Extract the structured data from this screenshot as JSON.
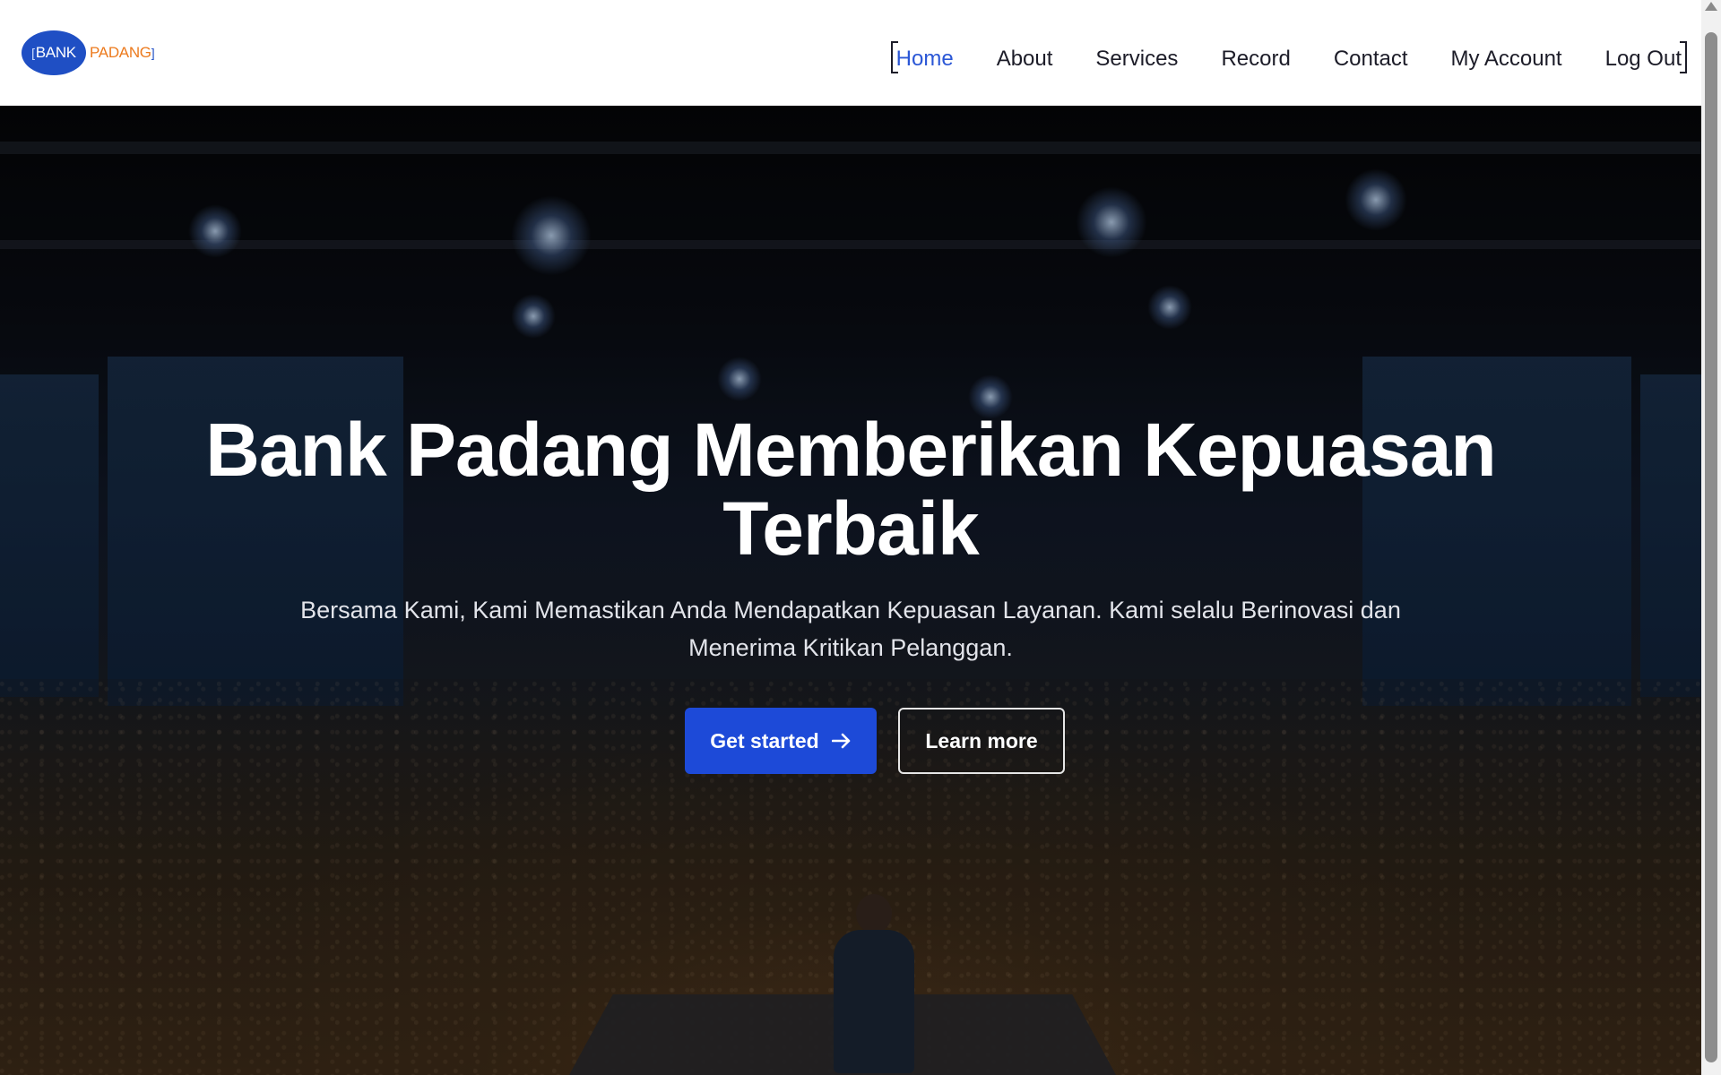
{
  "stray_text": "\";",
  "logo": {
    "left_bracket": "[",
    "bank": "BANK",
    "padang": "PADANG",
    "right_bracket": "]"
  },
  "nav": {
    "items": [
      {
        "label": "Home",
        "active": true
      },
      {
        "label": "About"
      },
      {
        "label": "Services"
      },
      {
        "label": "Record"
      },
      {
        "label": "Contact"
      },
      {
        "label": "My Account"
      },
      {
        "label": "Log Out"
      }
    ]
  },
  "hero": {
    "title": "Bank Padang Memberikan Kepuasan Terbaik",
    "subtitle": "Bersama Kami, Kami Memastikan Anda Mendapatkan Kepuasan Layanan. Kami selalu Berinovasi dan Menerima Kritikan Pelanggan.",
    "primary_button": "Get started",
    "primary_button_icon": "arrow-right-icon",
    "secondary_button": "Learn more"
  },
  "colors": {
    "brand_blue": "#1d4ad8",
    "brand_orange": "#ec7a1d",
    "nav_active": "#2b57d6"
  }
}
